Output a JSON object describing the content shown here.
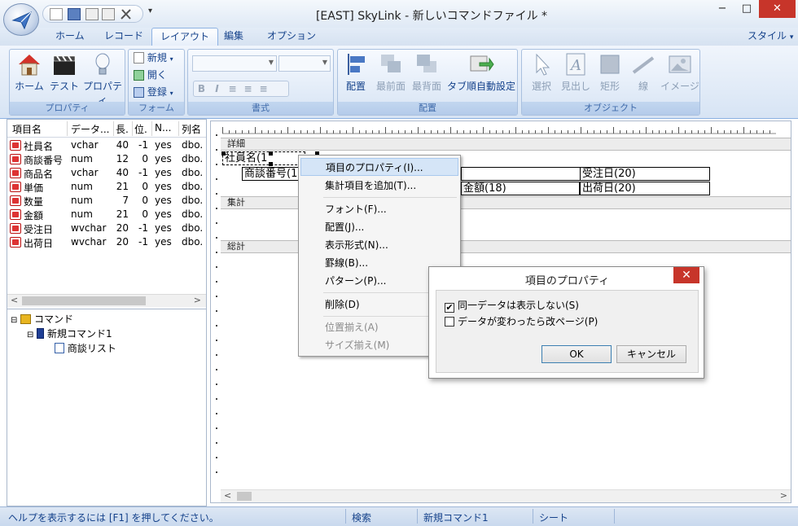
{
  "window": {
    "title": "[EAST] SkyLink - 新しいコマンドファイル *",
    "minimize": "−",
    "maximize": "□",
    "close": "✕",
    "qat_more": "▾"
  },
  "tabs": [
    {
      "label": "ホーム"
    },
    {
      "label": "レコード"
    },
    {
      "label": "レイアウト"
    },
    {
      "label": "編集"
    },
    {
      "label": "オプション"
    }
  ],
  "style_menu": "スタイル",
  "style_menu_arrow": "▾",
  "ribbon": {
    "property_group": {
      "label": "プロパティ",
      "buttons": [
        "ホーム",
        "テスト",
        "プロパティ"
      ]
    },
    "form_group": {
      "label": "フォーム",
      "new": "新規",
      "open": "開く",
      "register": "登録"
    },
    "format_group": {
      "label": "書式",
      "format_buttons": [
        "B",
        "I",
        "≡",
        "≡",
        "≡"
      ]
    },
    "arrange_group": {
      "label": "配置",
      "buttons": [
        "配置",
        "最前面",
        "最背面",
        "タブ順自動設定"
      ]
    },
    "object_group": {
      "label": "オブジェクト",
      "buttons": [
        "選択",
        "見出し",
        "矩形",
        "線",
        "イメージ"
      ]
    }
  },
  "fields": {
    "columns": [
      "項目名",
      "データ...",
      "長.",
      "位.",
      "N...",
      "列名"
    ],
    "rows": [
      [
        "社員名",
        "vchar",
        "40",
        "-1",
        "yes",
        "dbo."
      ],
      [
        "商談番号",
        "num",
        "12",
        "0",
        "yes",
        "dbo."
      ],
      [
        "商品名",
        "vchar",
        "40",
        "-1",
        "yes",
        "dbo."
      ],
      [
        "単価",
        "num",
        "21",
        "0",
        "yes",
        "dbo."
      ],
      [
        "数量",
        "num",
        "7",
        "0",
        "yes",
        "dbo."
      ],
      [
        "金額",
        "num",
        "21",
        "0",
        "yes",
        "dbo."
      ],
      [
        "受注日",
        "wvchar",
        "20",
        "-1",
        "yes",
        "dbo."
      ],
      [
        "出荷日",
        "wvchar",
        "20",
        "-1",
        "yes",
        "dbo."
      ]
    ],
    "scroll_left": "<",
    "scroll_right": ">"
  },
  "tree": {
    "root": "コマンド",
    "child": "新規コマンド1",
    "leaf": "商談リスト",
    "root_toggle": "⊟",
    "child_toggle": "⊟"
  },
  "designer": {
    "sections": [
      "詳細",
      "集計",
      "総計"
    ],
    "boxes": [
      "社員名(1",
      "商談番号(1",
      "受注日(20)",
      "金額(18)",
      "出荷日(20)"
    ],
    "scroll_left": "<",
    "scroll_right": ">"
  },
  "context_menu": {
    "items": [
      {
        "label": "項目のプロパティ(I)...",
        "state": "highlighted"
      },
      {
        "label": "集計項目を追加(T)...",
        "state": "normal"
      },
      {
        "label": "フォント(F)...",
        "state": "normal"
      },
      {
        "label": "配置(J)...",
        "state": "normal"
      },
      {
        "label": "表示形式(N)...",
        "state": "normal"
      },
      {
        "label": "罫線(B)...",
        "state": "normal"
      },
      {
        "label": "パターン(P)...",
        "state": "normal"
      },
      {
        "label": "削除(D)",
        "state": "normal"
      },
      {
        "label": "位置揃え(A)",
        "state": "disabled"
      },
      {
        "label": "サイズ揃え(M)",
        "state": "disabled"
      }
    ]
  },
  "dialog": {
    "title": "項目のプロパティ",
    "close": "✕",
    "options": [
      {
        "label": "同一データは表示しない(S)",
        "checked": true,
        "mark": "✔"
      },
      {
        "label": "データが変わったら改ページ(P)",
        "checked": false,
        "mark": ""
      }
    ],
    "ok": "OK",
    "cancel": "キャンセル"
  },
  "statusbar": {
    "help": "ヘルプを表示するには [F1] を押してください。",
    "search": "検索",
    "command": "新規コマンド1",
    "sheet": "シート"
  },
  "colors": {
    "accent": "#15428b",
    "ribbon_label": "#3e6aaa",
    "close_red": "#c7352a",
    "menu_highlight": "#d5e5f7"
  }
}
